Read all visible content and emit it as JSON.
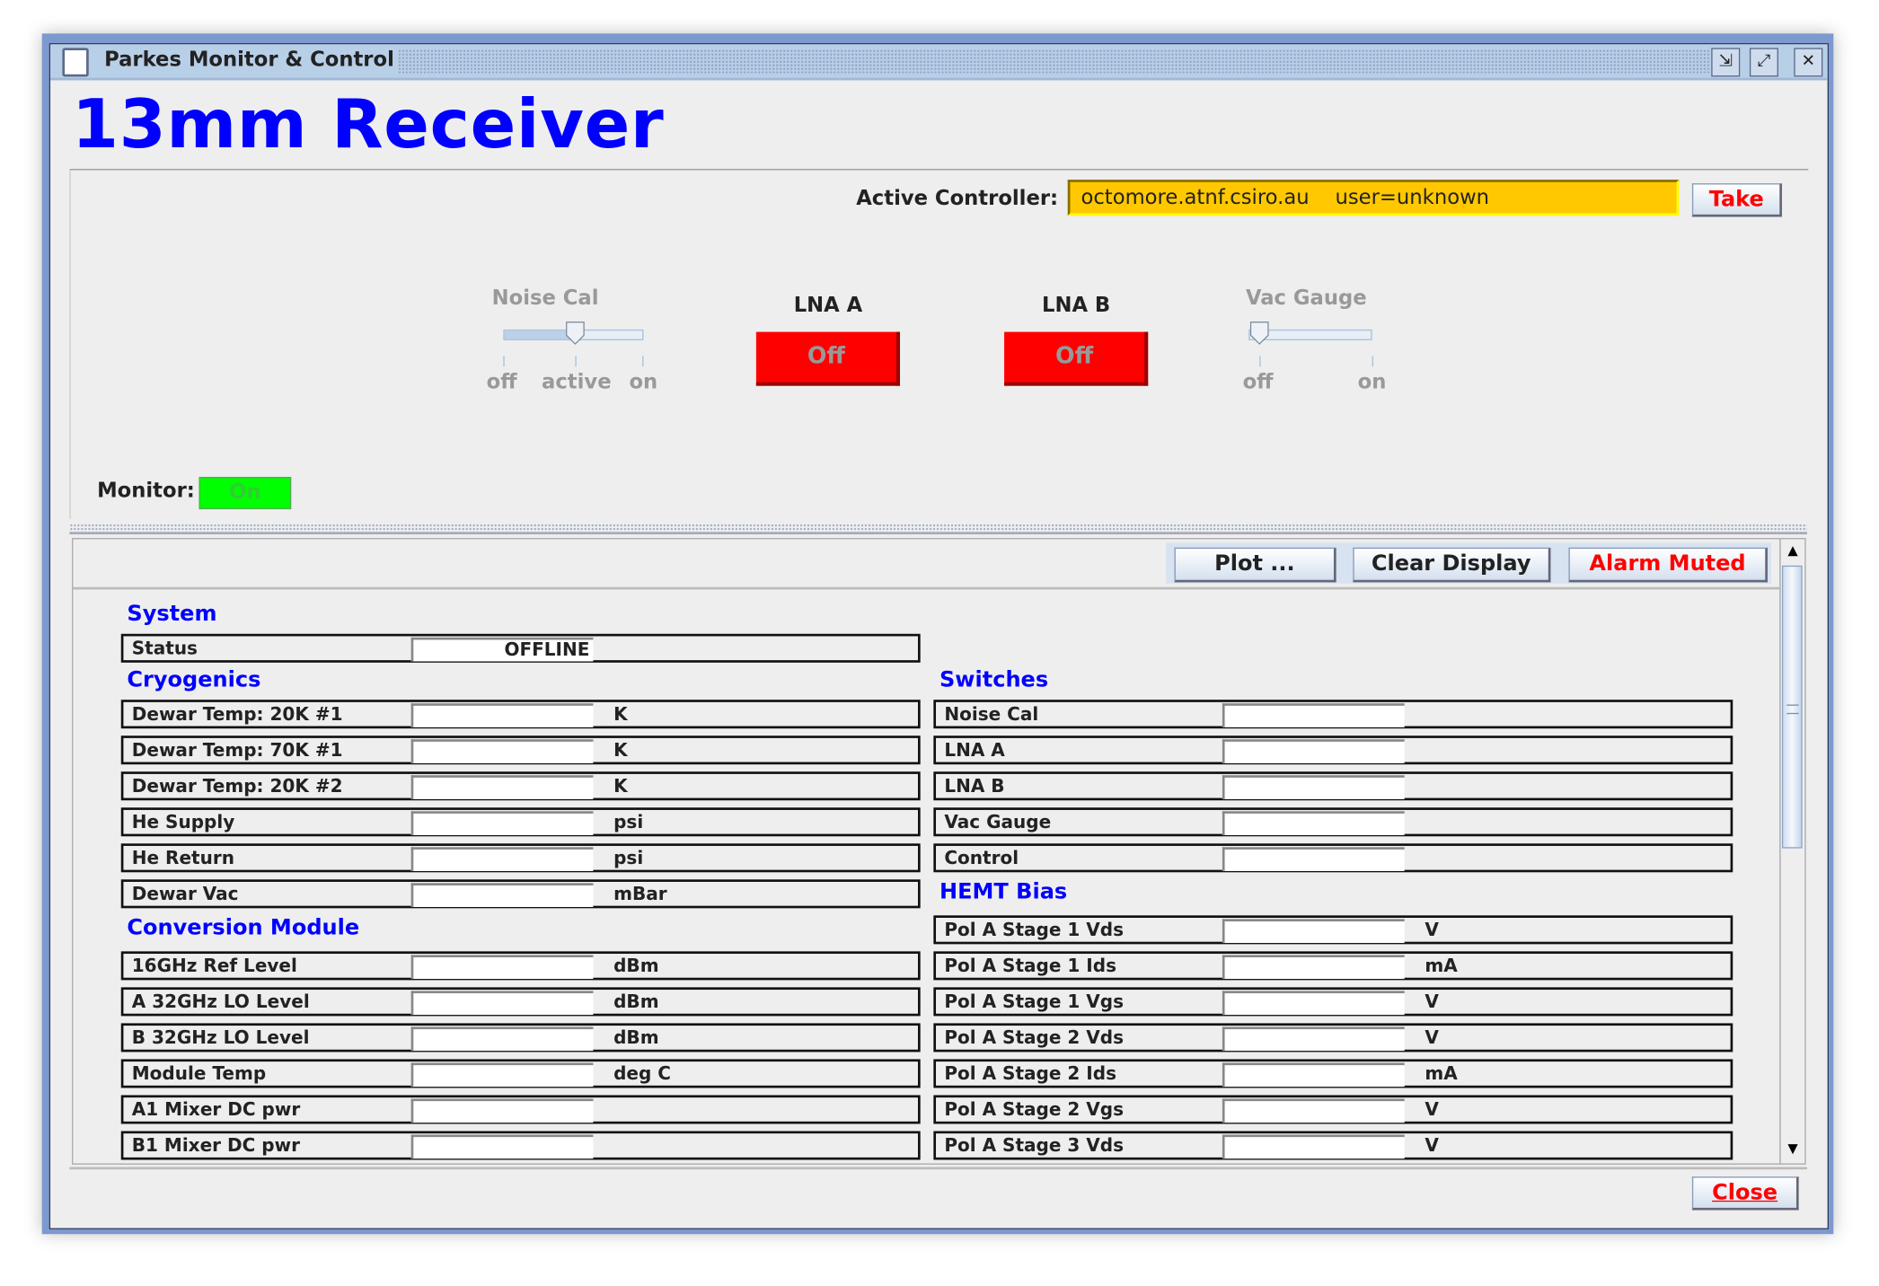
{
  "window": {
    "title": "Parkes Monitor & Control",
    "icons": [
      "iconify-icon",
      "maximize-icon",
      "close-icon"
    ]
  },
  "header": {
    "title": "13mm Receiver"
  },
  "controller": {
    "label": "Active Controller:",
    "value": "octomore.atnf.csiro.au    user=unknown",
    "take_label": "Take",
    "field_color": "#ffc800"
  },
  "controls": {
    "noise_cal": {
      "label": "Noise Cal",
      "ticks": [
        "off",
        "active",
        "on"
      ],
      "selected": "active"
    },
    "lna_a": {
      "label": "LNA A",
      "button": "Off",
      "color": "#ff0000"
    },
    "lna_b": {
      "label": "LNA B",
      "button": "Off",
      "color": "#ff0000"
    },
    "vac_gauge": {
      "label": "Vac Gauge",
      "ticks": [
        "off",
        "on"
      ],
      "selected": "off"
    }
  },
  "monitor": {
    "label": "Monitor:",
    "value": "On",
    "color": "#00ff00"
  },
  "toolbar": {
    "plot": "Plot ...",
    "clear": "Clear Display",
    "alarm": "Alarm Muted"
  },
  "sections": {
    "system": {
      "title": "System",
      "rows": [
        {
          "name": "Status",
          "value": "OFFLINE",
          "unit": ""
        }
      ]
    },
    "cryogenics": {
      "title": "Cryogenics",
      "rows": [
        {
          "name": "Dewar Temp: 20K #1",
          "value": "",
          "unit": "K"
        },
        {
          "name": "Dewar Temp: 70K #1",
          "value": "",
          "unit": "K"
        },
        {
          "name": "Dewar Temp: 20K #2",
          "value": "",
          "unit": "K"
        },
        {
          "name": "He Supply",
          "value": "",
          "unit": "psi"
        },
        {
          "name": "He Return",
          "value": "",
          "unit": "psi"
        },
        {
          "name": "Dewar Vac",
          "value": "",
          "unit": "mBar"
        }
      ]
    },
    "conversion": {
      "title": "Conversion Module",
      "rows": [
        {
          "name": "16GHz Ref Level",
          "value": "",
          "unit": "dBm"
        },
        {
          "name": "A 32GHz LO Level",
          "value": "",
          "unit": "dBm"
        },
        {
          "name": "B 32GHz LO Level",
          "value": "",
          "unit": "dBm"
        },
        {
          "name": "Module Temp",
          "value": "",
          "unit": "deg C"
        },
        {
          "name": "A1 Mixer DC pwr",
          "value": "",
          "unit": ""
        },
        {
          "name": "B1 Mixer DC pwr",
          "value": "",
          "unit": ""
        }
      ]
    },
    "switches": {
      "title": "Switches",
      "rows": [
        {
          "name": "Noise Cal",
          "value": "",
          "unit": ""
        },
        {
          "name": "LNA A",
          "value": "",
          "unit": ""
        },
        {
          "name": "LNA B",
          "value": "",
          "unit": ""
        },
        {
          "name": "Vac Gauge",
          "value": "",
          "unit": ""
        },
        {
          "name": "Control",
          "value": "",
          "unit": ""
        }
      ]
    },
    "hemt": {
      "title": "HEMT Bias",
      "rows": [
        {
          "name": "Pol A Stage 1 Vds",
          "value": "",
          "unit": "V"
        },
        {
          "name": "Pol A Stage 1 Ids",
          "value": "",
          "unit": "mA"
        },
        {
          "name": "Pol A Stage 1 Vgs",
          "value": "",
          "unit": "V"
        },
        {
          "name": "Pol A Stage 2 Vds",
          "value": "",
          "unit": "V"
        },
        {
          "name": "Pol A Stage 2 Ids",
          "value": "",
          "unit": "mA"
        },
        {
          "name": "Pol A Stage 2 Vgs",
          "value": "",
          "unit": "V"
        },
        {
          "name": "Pol A Stage 3 Vds",
          "value": "",
          "unit": "V"
        }
      ]
    }
  },
  "footer": {
    "close": "Close"
  }
}
